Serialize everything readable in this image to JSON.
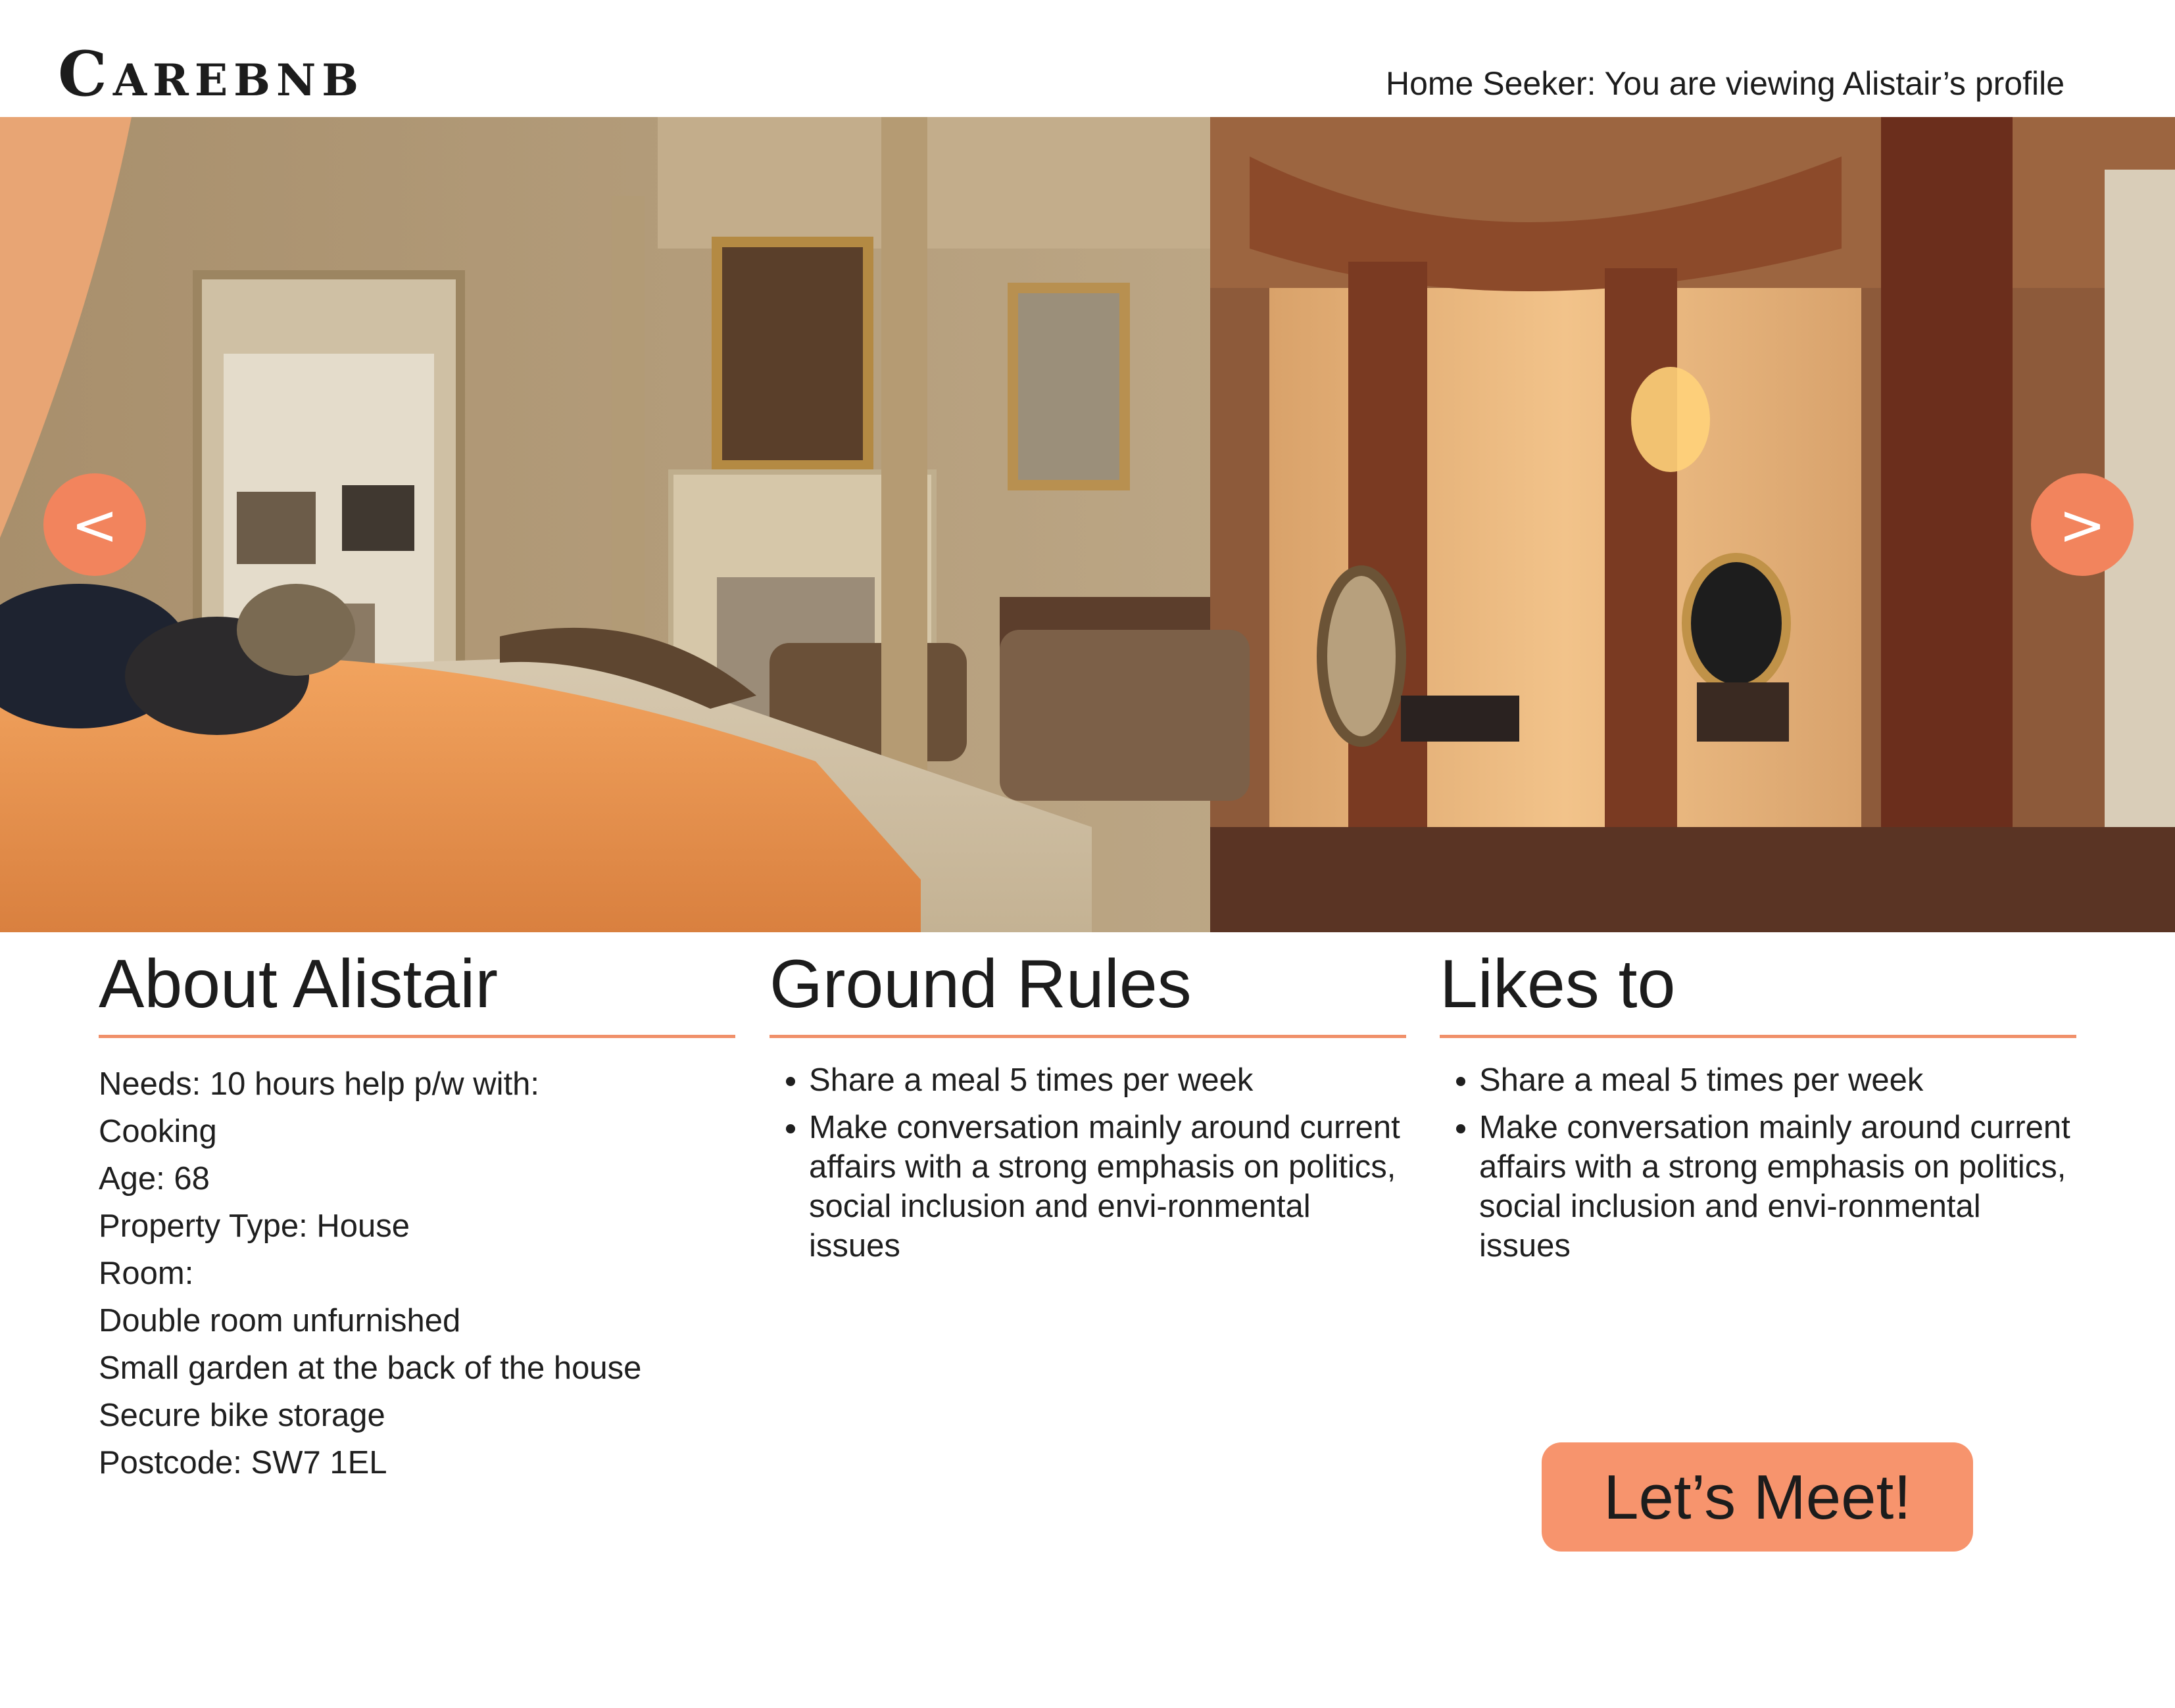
{
  "header": {
    "brand": "Carebnb",
    "viewer_status": "Home Seeker: You are viewing Alistair’s profile"
  },
  "gallery": {
    "prev_label": "<",
    "next_label": ">",
    "photo_icon": "bedroom-photo"
  },
  "about": {
    "title": "About Alistair",
    "lines": [
      "Needs: 10 hours help p/w with:",
      "Cooking",
      "Age: 68",
      "Property Type: House",
      "Room:",
      "Double room unfurnished",
      "Small garden at the back of the house",
      "Secure bike storage",
      "Postcode: SW7 1EL"
    ]
  },
  "ground_rules": {
    "title": "Ground Rules",
    "items": [
      "Share a meal 5 times per week",
      "Make conversation mainly around current affairs with a strong emphasis on politics, social inclusion and envi-ronmental issues"
    ]
  },
  "likes": {
    "title": "Likes to",
    "items": [
      "Share a meal 5 times per week",
      "Make conversation mainly around current affairs with a strong emphasis on politics, social inclusion and envi-ronmental issues"
    ]
  },
  "cta": {
    "label": "Let’s Meet!"
  },
  "colors": {
    "accent": "#f2845d",
    "divider": "#f0906a",
    "text": "#1c1c1c"
  }
}
